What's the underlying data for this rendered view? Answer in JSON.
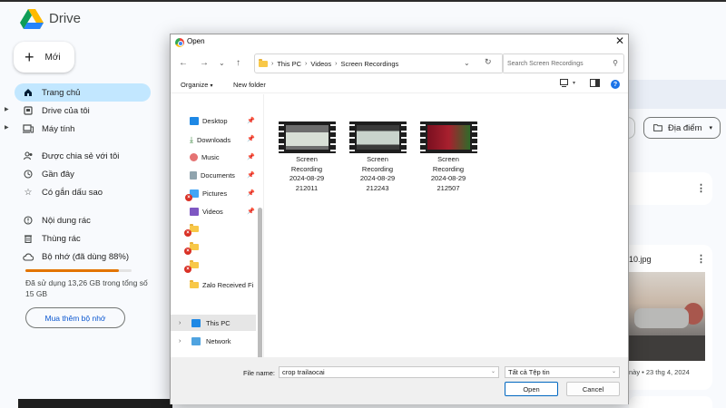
{
  "drive": {
    "app_name": "Drive",
    "new_label": "Mới",
    "nav": [
      {
        "label": "Trang chủ",
        "icon": "home-icon"
      },
      {
        "label": "Drive của tôi",
        "icon": "my-drive-icon"
      },
      {
        "label": "Máy tính",
        "icon": "computer-icon"
      },
      {
        "label": "Được chia sẻ với tôi",
        "icon": "shared-icon"
      },
      {
        "label": "Gần đây",
        "icon": "clock-icon"
      },
      {
        "label": "Có gắn dấu sao",
        "icon": "star-icon"
      },
      {
        "label": "Nội dung rác",
        "icon": "spam-icon"
      },
      {
        "label": "Thùng rác",
        "icon": "trash-icon"
      },
      {
        "label": "Bộ nhớ (đã dùng 88%)",
        "icon": "cloud-icon"
      }
    ],
    "storage_used_fraction": 0.88,
    "storage_text": "Đã sử dụng 13,26 GB trong tổng số 15 GB",
    "buy_storage_label": "Mua thêm bộ nhớ",
    "location_chip": "Địa điểm",
    "file_card": {
      "title": "10.jpg",
      "meta": "này • 23 thg 4, 2024"
    }
  },
  "dialog": {
    "title": "Open",
    "breadcrumb": [
      "This PC",
      "Videos",
      "Screen Recordings"
    ],
    "search_placeholder": "Search Screen Recordings",
    "organize_label": "Organize",
    "new_folder_label": "New folder",
    "quick_access": [
      {
        "label": "Desktop",
        "pinned": true
      },
      {
        "label": "Downloads",
        "pinned": true
      },
      {
        "label": "Music",
        "pinned": true
      },
      {
        "label": "Documents",
        "pinned": true
      },
      {
        "label": "Pictures",
        "pinned": true
      },
      {
        "label": "Videos",
        "pinned": true
      },
      {
        "label": "",
        "pinned": false
      },
      {
        "label": "",
        "pinned": false
      },
      {
        "label": "",
        "pinned": false
      },
      {
        "label": "Zalo Received Fi",
        "pinned": false
      }
    ],
    "tree": [
      {
        "label": "This PC"
      },
      {
        "label": "Network"
      }
    ],
    "files": [
      {
        "line1": "Screen",
        "line2": "Recording",
        "line3": "2024-08-29",
        "line4": "212011"
      },
      {
        "line1": "Screen",
        "line2": "Recording",
        "line3": "2024-08-29",
        "line4": "212243"
      },
      {
        "line1": "Screen",
        "line2": "Recording",
        "line3": "2024-08-29",
        "line4": "212507"
      }
    ],
    "file_name_label": "File name:",
    "file_name_value": "crop trailaocai",
    "file_type": "Tất cả Tệp tin",
    "open_label": "Open",
    "cancel_label": "Cancel"
  },
  "colors": {
    "active_nav": "#c2e7ff",
    "storage_fill": "#e37400",
    "link_blue": "#0b57d0",
    "dialog_accent": "#0067c0"
  }
}
